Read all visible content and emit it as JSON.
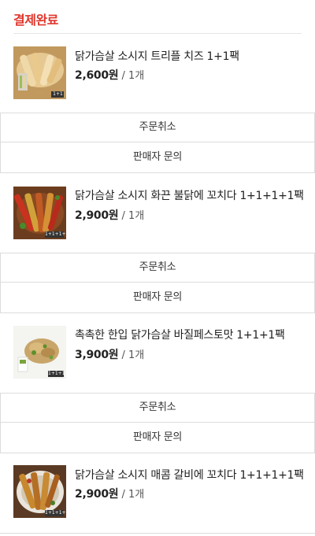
{
  "status": {
    "title": "결제완료"
  },
  "products": [
    {
      "name": "닭가슴살 소시지 트리플 치즈 1+1팩",
      "price": "2,600",
      "currency": "원",
      "qty": " / 1개",
      "badge": "1+1",
      "cancel_label": "주문취소",
      "inquiry_label": "판매자 문의"
    },
    {
      "name": "닭가슴살 소시지 화끈 불닭에 꼬치다 1+1+1+1팩",
      "price": "2,900",
      "currency": "원",
      "qty": " / 1개",
      "badge": "1+1+1+1",
      "cancel_label": "주문취소",
      "inquiry_label": "판매자 문의"
    },
    {
      "name": "촉촉한 한입 닭가슴살 바질페스토맛 1+1+1팩",
      "price": "3,900",
      "currency": "원",
      "qty": " / 1개",
      "badge": "1+1+1",
      "cancel_label": "주문취소",
      "inquiry_label": "판매자 문의"
    },
    {
      "name": "닭가슴살 소시지 매콤 갈비에 꼬치다 1+1+1+1팩",
      "price": "2,900",
      "currency": "원",
      "qty": " / 1개",
      "badge": "1+1+1+1"
    }
  ],
  "colors": {
    "status_accent": "#e0362c",
    "border": "#dcdcdc"
  }
}
